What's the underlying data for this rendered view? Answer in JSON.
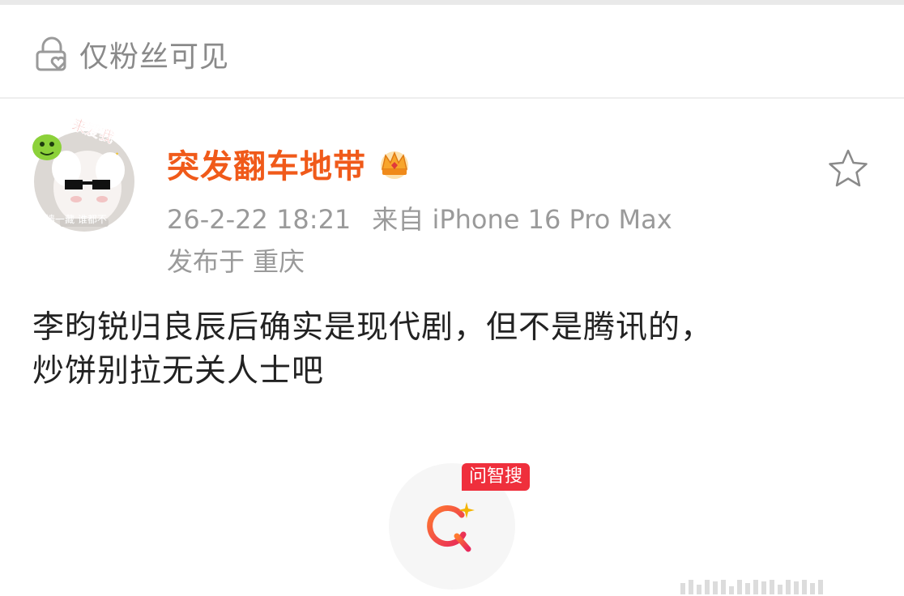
{
  "visibility": {
    "label": "仅粉丝可见"
  },
  "post": {
    "author": {
      "name": "突发翻车地带",
      "avatar_badge": "来爱我",
      "avatar_caption": "墙一藏 谁都不"
    },
    "timestamp": "26-2-22 18:21",
    "source": "来自 iPhone 16 Pro Max",
    "location": "发布于 重庆",
    "content_lines": [
      "李昀锐归良辰后确实是现代剧，但不是腾讯的，",
      "炒饼别拉无关人士吧"
    ]
  },
  "search_widget": {
    "badge": "问智搜"
  },
  "colors": {
    "accent": "#f05a1a",
    "badge_red": "#ef2f3c",
    "meta_gray": "#9a9a9a"
  },
  "icons": [
    "lock-heart-icon",
    "crown-icon",
    "star-icon",
    "search-sparkle-icon"
  ]
}
